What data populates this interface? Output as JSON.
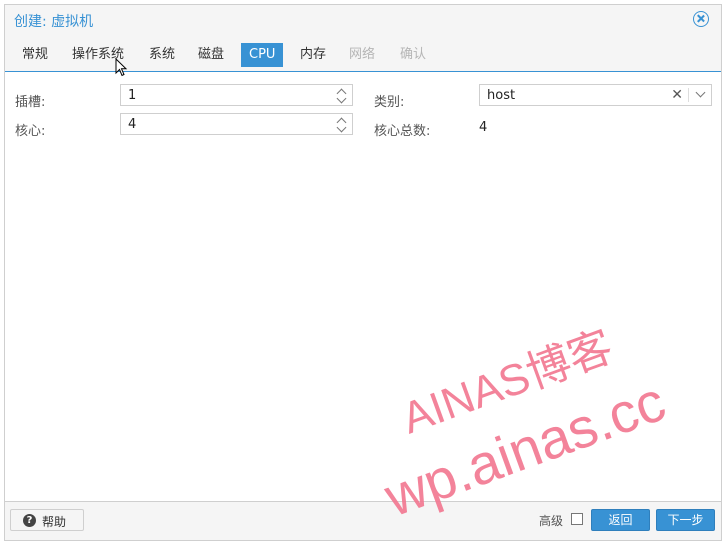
{
  "dialog": {
    "title": "创建: 虚拟机"
  },
  "tabs": [
    {
      "label": "常规",
      "state": "normal"
    },
    {
      "label": "操作系统",
      "state": "normal"
    },
    {
      "label": "系统",
      "state": "normal"
    },
    {
      "label": "磁盘",
      "state": "normal"
    },
    {
      "label": "CPU",
      "state": "active"
    },
    {
      "label": "内存",
      "state": "normal"
    },
    {
      "label": "网络",
      "state": "disabled"
    },
    {
      "label": "确认",
      "state": "disabled"
    }
  ],
  "cpu": {
    "sockets_label": "插槽:",
    "sockets_value": "1",
    "cores_label": "核心:",
    "cores_value": "4",
    "type_label": "类别:",
    "type_value": "host",
    "total_cores_label": "核心总数:",
    "total_cores_value": "4"
  },
  "footer": {
    "help_label": "帮助",
    "advanced_label": "高级",
    "back_label": "返回",
    "next_label": "下一步"
  },
  "watermark": {
    "line1": "AINAS博客",
    "line2": "wp.ainas.cc",
    "color": "#f2768f"
  },
  "colors": {
    "accent": "#3892d4"
  }
}
